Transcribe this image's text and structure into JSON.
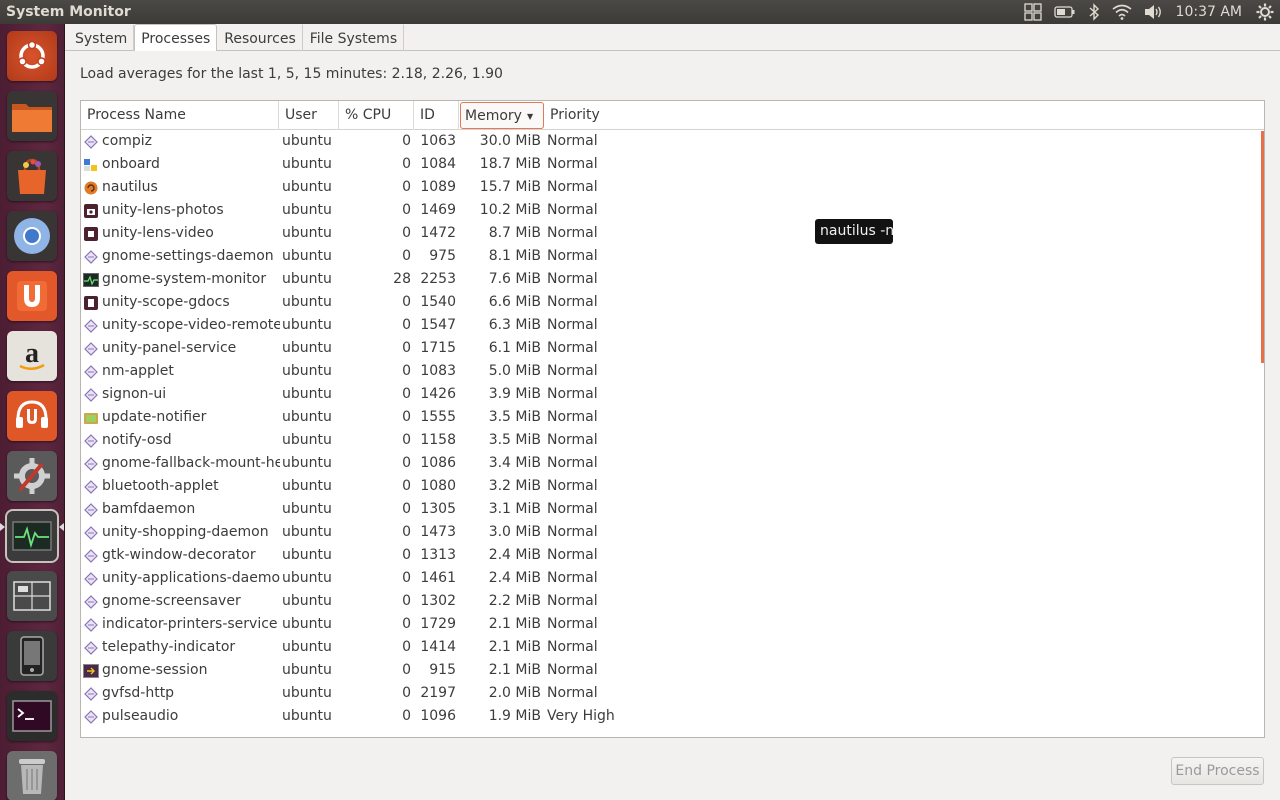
{
  "window": {
    "title": "System Monitor"
  },
  "top_panel": {
    "clock": "10:37 AM",
    "indicators": [
      "workspace-switcher-icon",
      "battery-icon",
      "bluetooth-icon",
      "wifi-icon",
      "volume-icon",
      "session-gear-icon"
    ]
  },
  "launcher": {
    "items": [
      {
        "name": "ubuntu-dash-icon",
        "color": "#c44022"
      },
      {
        "name": "files-folder-icon",
        "color": "#e9672c"
      },
      {
        "name": "software-center-bag-icon",
        "color": "#d3501f"
      },
      {
        "name": "chromium-browser-icon",
        "color": "#3f79c9"
      },
      {
        "name": "ubuntu-one-icon",
        "color": "#e2582a"
      },
      {
        "name": "amazon-icon",
        "color": "#e6e2dc"
      },
      {
        "name": "ubuntu-one-music-icon",
        "color": "#df5727"
      },
      {
        "name": "system-settings-icon",
        "color": "#8a8a8a"
      },
      {
        "name": "system-monitor-icon",
        "color": "#3b3b3b"
      },
      {
        "name": "workspace-switcher-launcher-icon",
        "color": "#4a4a4a"
      },
      {
        "name": "ubuntu-phone-icon",
        "color": "#3a3a3a"
      },
      {
        "name": "terminal-icon",
        "color": "#2c2c2c"
      },
      {
        "name": "trash-icon",
        "color": "#6d6d6d"
      }
    ]
  },
  "tabs": [
    {
      "label": "System",
      "active": false
    },
    {
      "label": "Processes",
      "active": true
    },
    {
      "label": "Resources",
      "active": false
    },
    {
      "label": "File Systems",
      "active": false
    }
  ],
  "load_averages": "Load averages for the last 1, 5, 15 minutes: 2.18, 2.26, 1.90",
  "columns": {
    "name": "Process Name",
    "user": "User",
    "cpu": "% CPU",
    "id": "ID",
    "memory": "Memory",
    "priority": "Priority",
    "sorted_by": "memory"
  },
  "processes": [
    {
      "name": "compiz",
      "user": "ubuntu",
      "cpu": "0",
      "id": "1063",
      "memory": "30.0 MiB",
      "priority": "Normal",
      "icon": "generic-process-icon"
    },
    {
      "name": "onboard",
      "user": "ubuntu",
      "cpu": "0",
      "id": "1084",
      "memory": "18.7 MiB",
      "priority": "Normal",
      "icon": "onboard-keyboard-icon"
    },
    {
      "name": "nautilus",
      "user": "ubuntu",
      "cpu": "0",
      "id": "1089",
      "memory": "15.7 MiB",
      "priority": "Normal",
      "icon": "nautilus-icon"
    },
    {
      "name": "unity-lens-photos",
      "user": "ubuntu",
      "cpu": "0",
      "id": "1469",
      "memory": "10.2 MiB",
      "priority": "Normal",
      "icon": "camera-lens-icon"
    },
    {
      "name": "unity-lens-video",
      "user": "ubuntu",
      "cpu": "0",
      "id": "1472",
      "memory": "8.7 MiB",
      "priority": "Normal",
      "icon": "video-lens-icon"
    },
    {
      "name": "gnome-settings-daemon",
      "user": "ubuntu",
      "cpu": "0",
      "id": "975",
      "memory": "8.1 MiB",
      "priority": "Normal",
      "icon": "generic-process-icon"
    },
    {
      "name": "gnome-system-monitor",
      "user": "ubuntu",
      "cpu": "28",
      "id": "2253",
      "memory": "7.6 MiB",
      "priority": "Normal",
      "icon": "system-monitor-small-icon"
    },
    {
      "name": "unity-scope-gdocs",
      "user": "ubuntu",
      "cpu": "0",
      "id": "1540",
      "memory": "6.6 MiB",
      "priority": "Normal",
      "icon": "gdocs-scope-icon"
    },
    {
      "name": "unity-scope-video-remote",
      "user": "ubuntu",
      "cpu": "0",
      "id": "1547",
      "memory": "6.3 MiB",
      "priority": "Normal",
      "icon": "generic-process-icon"
    },
    {
      "name": "unity-panel-service",
      "user": "ubuntu",
      "cpu": "0",
      "id": "1715",
      "memory": "6.1 MiB",
      "priority": "Normal",
      "icon": "generic-process-icon"
    },
    {
      "name": "nm-applet",
      "user": "ubuntu",
      "cpu": "0",
      "id": "1083",
      "memory": "5.0 MiB",
      "priority": "Normal",
      "icon": "generic-process-icon"
    },
    {
      "name": "signon-ui",
      "user": "ubuntu",
      "cpu": "0",
      "id": "1426",
      "memory": "3.9 MiB",
      "priority": "Normal",
      "icon": "generic-process-icon"
    },
    {
      "name": "update-notifier",
      "user": "ubuntu",
      "cpu": "0",
      "id": "1555",
      "memory": "3.5 MiB",
      "priority": "Normal",
      "icon": "update-notifier-icon"
    },
    {
      "name": "notify-osd",
      "user": "ubuntu",
      "cpu": "0",
      "id": "1158",
      "memory": "3.5 MiB",
      "priority": "Normal",
      "icon": "generic-process-icon"
    },
    {
      "name": "gnome-fallback-mount-helper",
      "user": "ubuntu",
      "cpu": "0",
      "id": "1086",
      "memory": "3.4 MiB",
      "priority": "Normal",
      "icon": "generic-process-icon"
    },
    {
      "name": "bluetooth-applet",
      "user": "ubuntu",
      "cpu": "0",
      "id": "1080",
      "memory": "3.2 MiB",
      "priority": "Normal",
      "icon": "generic-process-icon"
    },
    {
      "name": "bamfdaemon",
      "user": "ubuntu",
      "cpu": "0",
      "id": "1305",
      "memory": "3.1 MiB",
      "priority": "Normal",
      "icon": "generic-process-icon"
    },
    {
      "name": "unity-shopping-daemon",
      "user": "ubuntu",
      "cpu": "0",
      "id": "1473",
      "memory": "3.0 MiB",
      "priority": "Normal",
      "icon": "generic-process-icon"
    },
    {
      "name": "gtk-window-decorator",
      "user": "ubuntu",
      "cpu": "0",
      "id": "1313",
      "memory": "2.4 MiB",
      "priority": "Normal",
      "icon": "generic-process-icon"
    },
    {
      "name": "unity-applications-daemon",
      "user": "ubuntu",
      "cpu": "0",
      "id": "1461",
      "memory": "2.4 MiB",
      "priority": "Normal",
      "icon": "generic-process-icon"
    },
    {
      "name": "gnome-screensaver",
      "user": "ubuntu",
      "cpu": "0",
      "id": "1302",
      "memory": "2.2 MiB",
      "priority": "Normal",
      "icon": "generic-process-icon"
    },
    {
      "name": "indicator-printers-service",
      "user": "ubuntu",
      "cpu": "0",
      "id": "1729",
      "memory": "2.1 MiB",
      "priority": "Normal",
      "icon": "generic-process-icon"
    },
    {
      "name": "telepathy-indicator",
      "user": "ubuntu",
      "cpu": "0",
      "id": "1414",
      "memory": "2.1 MiB",
      "priority": "Normal",
      "icon": "generic-process-icon"
    },
    {
      "name": "gnome-session",
      "user": "ubuntu",
      "cpu": "0",
      "id": "915",
      "memory": "2.1 MiB",
      "priority": "Normal",
      "icon": "gnome-session-icon"
    },
    {
      "name": "gvfsd-http",
      "user": "ubuntu",
      "cpu": "0",
      "id": "2197",
      "memory": "2.0 MiB",
      "priority": "Normal",
      "icon": "generic-process-icon"
    },
    {
      "name": "pulseaudio",
      "user": "ubuntu",
      "cpu": "0",
      "id": "1096",
      "memory": "1.9 MiB",
      "priority": "Very High",
      "icon": "generic-process-icon"
    }
  ],
  "tooltip": "nautilus -n",
  "end_process_label": "End Process",
  "colors": {
    "accent": "#e57049",
    "launcher_bg": "#5e2740",
    "panel_bg": "#3c3b37"
  }
}
